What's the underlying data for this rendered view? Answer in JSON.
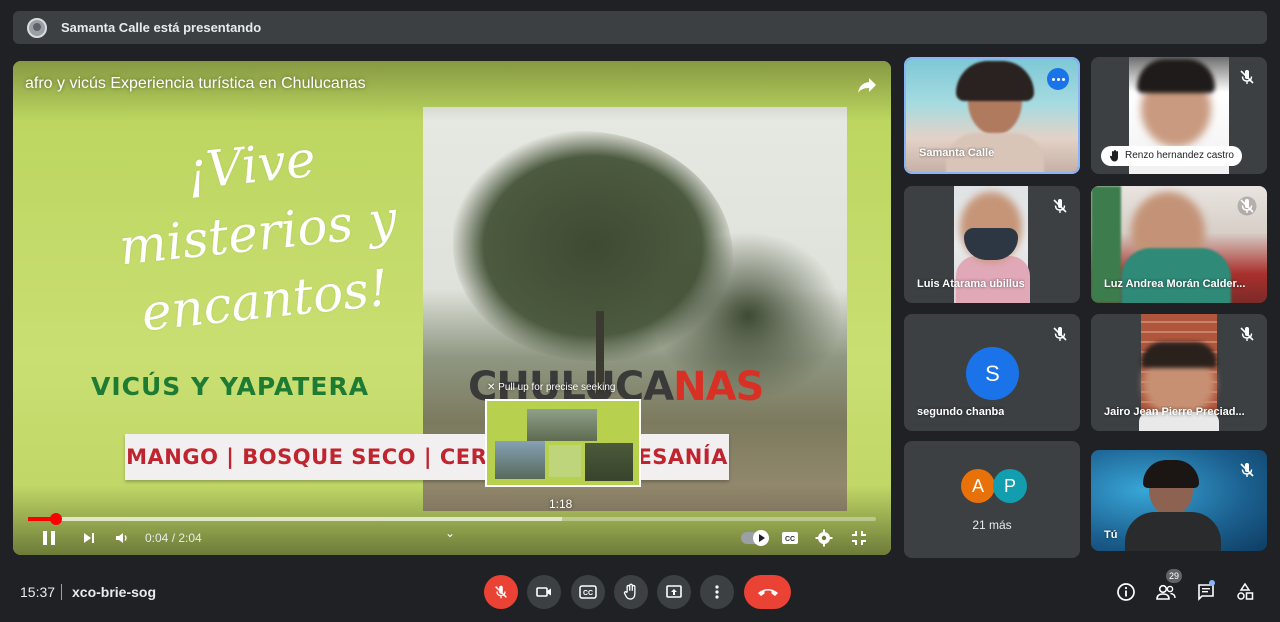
{
  "banner": {
    "text": "Samanta Calle está presentando"
  },
  "video": {
    "title": "afro y vicús Experiencia turística en Chulucanas",
    "slide": {
      "script_text": "¡Vive misterios y encantos!",
      "heading": "VICÚS Y YAPATERA",
      "photo_sign": {
        "dark": "CHULUCA",
        "red": "NAS"
      },
      "strip": "MANGO | BOSQUE SECO | CERÁMICA | ARTESANÍA"
    },
    "seek_hint": "✕ Pull up for precise seeking",
    "seek_time": "1:18",
    "time": "0:04 / 2:04",
    "progress": {
      "played_fraction": 0.033,
      "buffered_fraction": 0.63
    }
  },
  "participants": [
    {
      "name": "Samanta Calle",
      "active": true
    },
    {
      "name": "Renzo hernandez castro",
      "hand_raised": true
    },
    {
      "name": "Luis Atarama ubillus"
    },
    {
      "name": "Luz Andrea Morán Calder..."
    },
    {
      "name": "segundo chanba",
      "initial": "S"
    },
    {
      "name": "Jairo Jean Pierre Preciad..."
    },
    {
      "initials": [
        "A",
        "P"
      ],
      "more": "21 más"
    },
    {
      "name": "Tú"
    }
  ],
  "colors": {
    "avatar_blue": "#1a73e8",
    "avatar_orange": "#e8710a",
    "avatar_teal": "#129eaf",
    "danger": "#ea4335"
  },
  "bottom": {
    "time": "15:37",
    "code": "xco-brie-sog",
    "people_count": "29"
  }
}
